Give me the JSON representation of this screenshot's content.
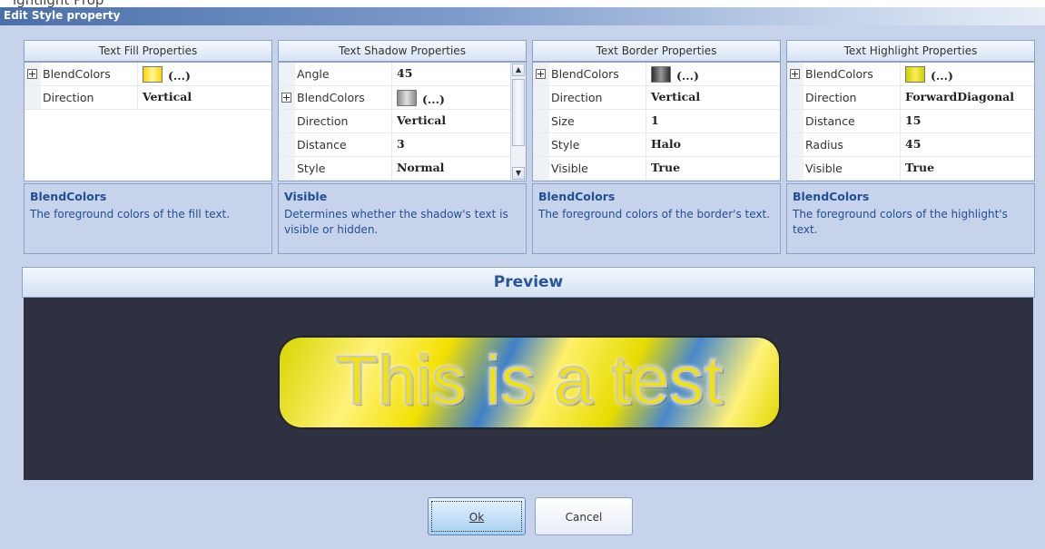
{
  "window": {
    "top_strip_text": "ightlight Prop",
    "title": "Edit Style property"
  },
  "panels": [
    {
      "title": "Text Fill Properties",
      "rows": [
        {
          "name": "BlendColors",
          "value": "(...)",
          "expandable": true,
          "swatch": "yellow"
        },
        {
          "name": "Direction",
          "value": "Vertical"
        }
      ],
      "description": {
        "title": "BlendColors",
        "text": "The foreground colors of the fill text."
      }
    },
    {
      "title": "Text Shadow Properties",
      "rows": [
        {
          "name": "Angle",
          "value": "45"
        },
        {
          "name": "BlendColors",
          "value": "(...)",
          "expandable": true,
          "swatch": "gray"
        },
        {
          "name": "Direction",
          "value": "Vertical"
        },
        {
          "name": "Distance",
          "value": "3"
        },
        {
          "name": "Style",
          "value": "Normal"
        }
      ],
      "description": {
        "title": "Visible",
        "text": "Determines whether the shadow's text is visible or hidden."
      }
    },
    {
      "title": "Text Border Properties",
      "rows": [
        {
          "name": "BlendColors",
          "value": "(...)",
          "expandable": true,
          "swatch": "dark"
        },
        {
          "name": "Direction",
          "value": "Vertical"
        },
        {
          "name": "Size",
          "value": "1"
        },
        {
          "name": "Style",
          "value": "Halo"
        },
        {
          "name": "Visible",
          "value": "True"
        }
      ],
      "description": {
        "title": "BlendColors",
        "text": "The foreground colors of the border's text."
      }
    },
    {
      "title": "Text Highlight Properties",
      "rows": [
        {
          "name": "BlendColors",
          "value": "(...)",
          "expandable": true,
          "swatch": "green"
        },
        {
          "name": "Direction",
          "value": "ForwardDiagonal"
        },
        {
          "name": "Distance",
          "value": "15"
        },
        {
          "name": "Radius",
          "value": "45"
        },
        {
          "name": "Visible",
          "value": "True"
        }
      ],
      "description": {
        "title": "BlendColors",
        "text": "The foreground colors of the highlight's text."
      }
    }
  ],
  "preview": {
    "header": "Preview",
    "sample_text": "This is a test"
  },
  "buttons": {
    "ok": "Ok",
    "cancel": "Cancel"
  },
  "colors": {
    "dialog_bg": "#c6d3ea",
    "accent_text": "#1f4f95",
    "preview_bg": "#2e3240",
    "sample_fill": "#f3e500"
  }
}
